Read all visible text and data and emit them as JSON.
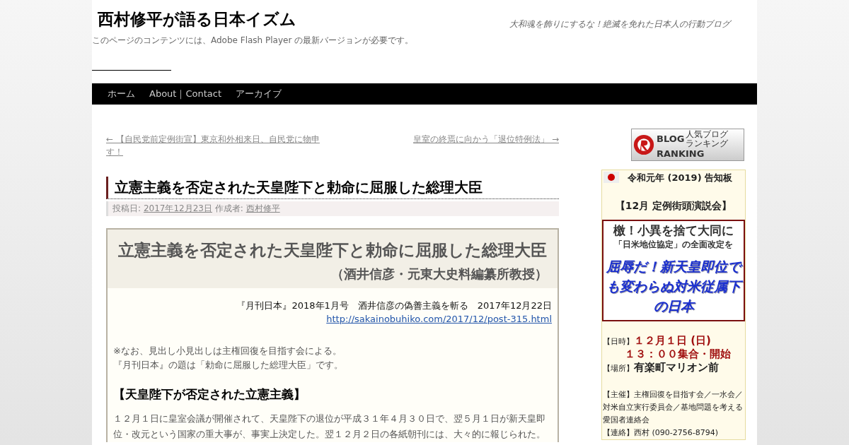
{
  "header": {
    "site_title": "西村修平が語る日本イズム",
    "tagline": "大和魂を飾りにするな！絶滅を免れた日本人の行動ブログ",
    "flash_notice": "このページのコンテンツには、Adobe Flash Player の最新バージョンが必要です。"
  },
  "nav": [
    {
      "label": "ホーム"
    },
    {
      "label": "About｜Contact"
    },
    {
      "label": "アーカイブ"
    }
  ],
  "post_nav": {
    "previous": "← 【自民党前定例街宣】東京和外相来日、自民党に物申す！",
    "next": "皇室の終焉に向かう「退位特例法」 →"
  },
  "post": {
    "title": "立憲主義を否定された天皇陛下と勅命に屈服した総理大臣",
    "meta_posted_label": "投稿日:",
    "meta_date": "2017年12月23日",
    "meta_author_label": "作成者:",
    "meta_author": "西村修平"
  },
  "article": {
    "heading": "立憲主義を否定された天皇陛下と勅命に屈服した総理大臣",
    "subheading": "（酒井信彦・元東大史料編纂所教授）",
    "source": "『月刊日本』2018年1月号　酒井信彦の偽善主義を斬る　2017年12月22日",
    "source_link": "http://sakainobuhiko.com/2017/12/post-315.html",
    "notes": [
      "※なお、見出し小見出しは主権回復を目指す会による。",
      "『月刊日本』の題は「勅命に屈服した総理大臣」です。"
    ],
    "section_heading": "【天皇陛下が否定された立憲主義】",
    "paragraph": "１２月１日に皇室会議が開催されて、天皇陛下の退位が平成３１年４月３０日で、翌５月１日が新天皇即位・改元という国家の重大事が、事実上決定した。翌１２月２日の各紙朝刊には、大々的に報じられた。"
  },
  "sidebar": {
    "banner": {
      "line_1": "BLOG",
      "line_2": "RANKING",
      "small": [
        "人気ブログ",
        "ランキング"
      ]
    },
    "notice": {
      "title": "令和元年 (2019) 告知板",
      "event": "【12月 定例街頭演説会】",
      "box_line_1": "檄！小異を捨て大同に",
      "box_line_2": "「日米地位協定」の全面改定を",
      "box_slogan": "屈辱だ！新天皇即位でも変わらぬ対米従属下の日本",
      "date_label": "【日時】",
      "date_value": "１２月１日 (日)",
      "time_value": "１３：００集合・開始",
      "place_label": "【場所】",
      "place_value": "有楽町マリオン前",
      "organizers": "【主催】主権回復を目指す会／一水会／対米自立実行委員会／基地問題を考える愛国者連絡会",
      "contact": "【連絡】西村 (090-2756-8794)"
    }
  }
}
